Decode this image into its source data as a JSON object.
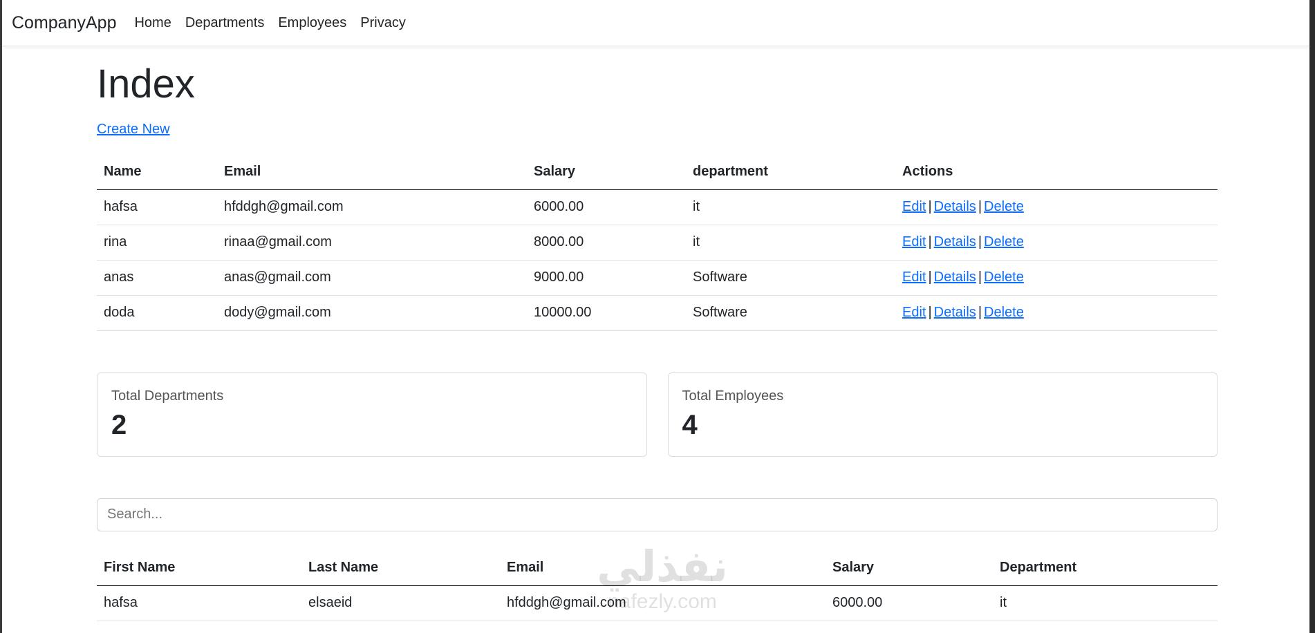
{
  "nav": {
    "brand": "CompanyApp",
    "links": [
      "Home",
      "Departments",
      "Employees",
      "Privacy"
    ]
  },
  "page": {
    "title": "Index",
    "create_link": "Create New"
  },
  "employees_table": {
    "headers": [
      "Name",
      "Email",
      "Salary",
      "department",
      "Actions"
    ],
    "rows": [
      {
        "name": "hafsa",
        "email": "hfddgh@gmail.com",
        "salary": "6000.00",
        "department": "it"
      },
      {
        "name": "rina",
        "email": "rinaa@gmail.com",
        "salary": "8000.00",
        "department": "it"
      },
      {
        "name": "anas",
        "email": "anas@gmail.com",
        "salary": "9000.00",
        "department": "Software"
      },
      {
        "name": "doda",
        "email": "dody@gmail.com",
        "salary": "10000.00",
        "department": "Software"
      }
    ],
    "actions": {
      "edit": "Edit",
      "details": "Details",
      "delete": "Delete",
      "separator": "|"
    }
  },
  "cards": [
    {
      "title": "Total Departments",
      "value": "2"
    },
    {
      "title": "Total Employees",
      "value": "4"
    }
  ],
  "search": {
    "placeholder": "Search..."
  },
  "search_table": {
    "headers": [
      "First Name",
      "Last Name",
      "Email",
      "Salary",
      "Department"
    ],
    "rows": [
      {
        "first_name": "hafsa",
        "last_name": "elsaeid",
        "email": "hfddgh@gmail.com",
        "salary": "6000.00",
        "department": "it"
      }
    ]
  },
  "watermark": {
    "arabic": "نفذلي",
    "url": "nafezly.com"
  }
}
